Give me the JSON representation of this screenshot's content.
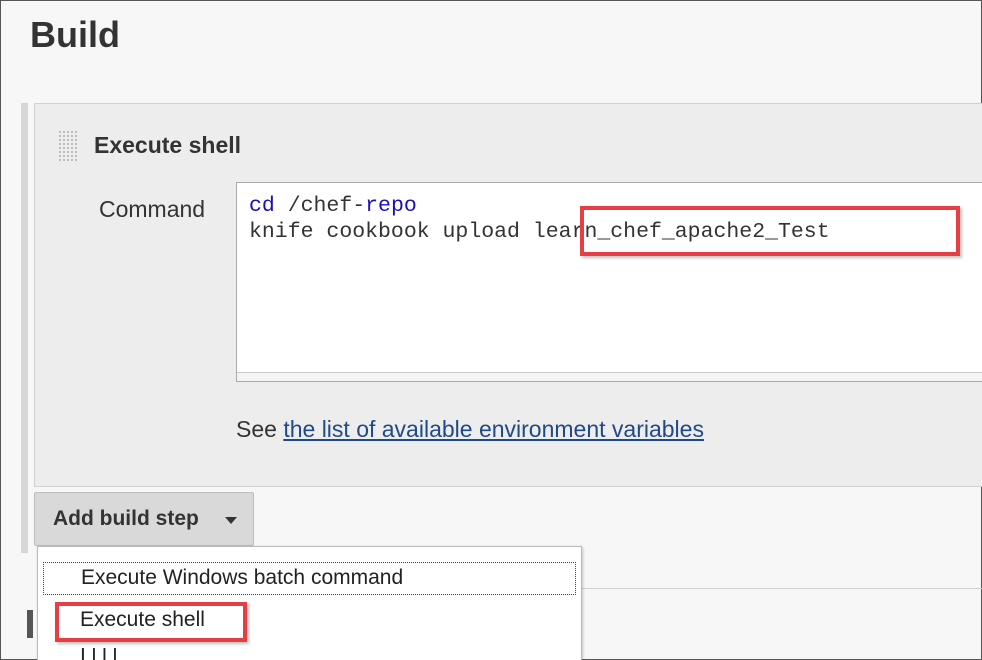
{
  "section": {
    "title": "Build"
  },
  "step": {
    "title": "Execute shell",
    "command_label": "Command",
    "command_lines": [
      {
        "keyword": "cd",
        "rest": " /chef-",
        "keyword2": "repo"
      },
      {
        "text": "knife cookbook upload ",
        "highlighted": "learn_chef_apache2_Test"
      }
    ],
    "help_prefix": "See ",
    "help_link": "the list of available environment variables"
  },
  "add_build_step": {
    "label": "Add build step"
  },
  "menu": {
    "items": [
      "Execute Windows batch command",
      "Execute shell"
    ]
  },
  "colors": {
    "highlight": "#e53e44",
    "link": "#204a87",
    "keyword": "#1b10b8"
  }
}
